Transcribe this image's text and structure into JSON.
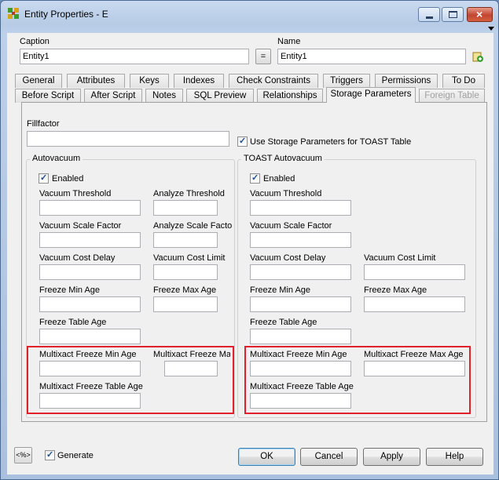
{
  "window": {
    "title": "Entity Properties - E"
  },
  "header": {
    "caption_label": "Caption",
    "caption_value": "Entity1",
    "equal_button": "=",
    "name_label": "Name",
    "name_value": "Entity1"
  },
  "tabs_row1": [
    "General",
    "Attributes",
    "Keys",
    "Indexes",
    "Check Constraints",
    "Triggers",
    "Permissions",
    "To Do"
  ],
  "tabs_row2": [
    "Before Script",
    "After Script",
    "Notes",
    "SQL Preview",
    "Relationships",
    "Storage Parameters",
    "Foreign Table"
  ],
  "panel": {
    "fillfactor_label": "Fillfactor",
    "toast_checkbox_label": "Use Storage Parameters for TOAST Table",
    "autovacuum": {
      "title": "Autovacuum",
      "enabled_label": "Enabled",
      "vacuum_threshold": "Vacuum Threshold",
      "analyze_threshold": "Analyze Threshold",
      "vacuum_scale_factor": "Vacuum Scale Factor",
      "analyze_scale_factor": "Analyze Scale Facto",
      "vacuum_cost_delay": "Vacuum Cost Delay",
      "vacuum_cost_limit": "Vacuum Cost Limit",
      "freeze_min_age": "Freeze Min Age",
      "freeze_max_age": "Freeze Max Age",
      "freeze_table_age": "Freeze Table Age",
      "multixact_freeze_min_age": "Multixact Freeze Min Age",
      "multixact_freeze_max_age": "Multixact Freeze Ma:",
      "multixact_freeze_table_age": "Multixact Freeze Table Age"
    },
    "toast": {
      "title": "TOAST Autovacuum",
      "enabled_label": "Enabled",
      "vacuum_threshold": "Vacuum Threshold",
      "vacuum_scale_factor": "Vacuum Scale Factor",
      "vacuum_cost_delay": "Vacuum Cost Delay",
      "vacuum_cost_limit": "Vacuum Cost Limit",
      "freeze_min_age": "Freeze Min Age",
      "freeze_max_age": "Freeze Max Age",
      "freeze_table_age": "Freeze Table Age",
      "multixact_freeze_min_age": "Multixact Freeze Min Age",
      "multixact_freeze_max_age": "Multixact Freeze Max Age",
      "multixact_freeze_table_age": "Multixact Freeze Table Age"
    }
  },
  "footer": {
    "generate_label": "Generate",
    "ok": "OK",
    "cancel": "Cancel",
    "apply": "Apply",
    "help": "Help"
  },
  "colors": {
    "highlight_box": "#e0202a",
    "titlebar": "#b7cbe6"
  }
}
